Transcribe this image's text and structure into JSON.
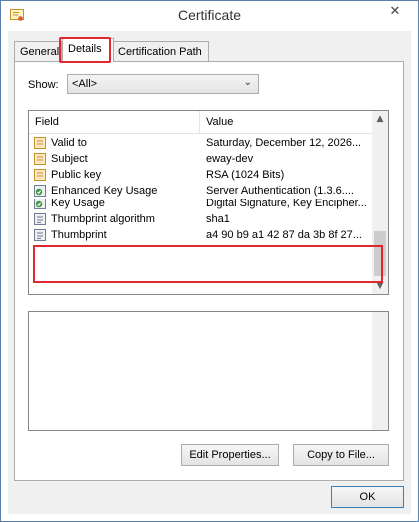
{
  "window": {
    "title": "Certificate",
    "close_glyph": "✕"
  },
  "tabs": [
    {
      "label": "General"
    },
    {
      "label": "Details"
    },
    {
      "label": "Certification Path"
    }
  ],
  "show": {
    "label": "Show:",
    "selected": "<All>"
  },
  "list": {
    "headers": {
      "field": "Field",
      "value": "Value"
    },
    "rows": [
      {
        "field": "Valid to",
        "value": "Saturday, December 12, 2026...",
        "icon": "certificate-property-icon"
      },
      {
        "field": "Subject",
        "value": "eway-dev",
        "icon": "certificate-property-icon"
      },
      {
        "field": "Public key",
        "value": "RSA (1024 Bits)",
        "icon": "certificate-property-icon"
      },
      {
        "field": "Enhanced Key Usage",
        "value": "Server Authentication (1.3.6....",
        "icon": "certificate-extension-icon"
      },
      {
        "field": "Key Usage",
        "value": "Digital Signature, Key Encipher...",
        "icon": "certificate-extension-icon"
      },
      {
        "field": "Thumbprint algorithm",
        "value": "sha1",
        "icon": "certificate-document-icon"
      },
      {
        "field": "Thumbprint",
        "value": "a4 90 b9 a1 42 87 da 3b 8f 27...",
        "icon": "certificate-document-icon"
      }
    ]
  },
  "buttons": {
    "edit_properties": "Edit Properties...",
    "copy_to_file": "Copy to File...",
    "ok": "OK"
  },
  "colors": {
    "highlight": "#e0262e"
  }
}
